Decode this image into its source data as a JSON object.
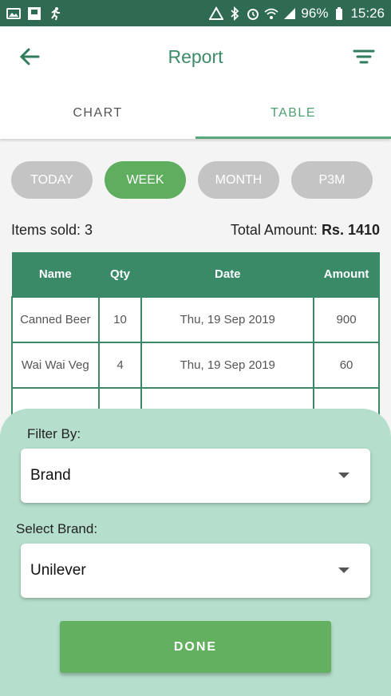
{
  "status_bar": {
    "battery_percent": "96%",
    "time": "15:26",
    "left_icons": [
      "image-icon",
      "screenshot-icon",
      "running-icon"
    ],
    "right_icons": [
      "network-icon",
      "bluetooth-icon",
      "alarm-icon",
      "wifi-icon",
      "signal-icon",
      "battery-icon"
    ]
  },
  "app_bar": {
    "title": "Report"
  },
  "tabs": [
    {
      "label": "CHART",
      "active": false
    },
    {
      "label": "TABLE",
      "active": true
    }
  ],
  "period_chips": [
    {
      "label": "TODAY",
      "active": false
    },
    {
      "label": "WEEK",
      "active": true
    },
    {
      "label": "MONTH",
      "active": false
    },
    {
      "label": "P3M",
      "active": false
    }
  ],
  "summary": {
    "items_sold": "Items sold: 3",
    "total_label": "Total Amount:",
    "total_value": "Rs. 1410"
  },
  "table": {
    "headers": [
      "Name",
      "Qty",
      "Date",
      "Amount"
    ],
    "rows": [
      [
        "Canned Beer",
        "10",
        "Thu, 19 Sep 2019",
        "900"
      ],
      [
        "Wai Wai Veg",
        "4",
        "Thu, 19 Sep 2019",
        "60"
      ]
    ]
  },
  "bottom_sheet": {
    "filter_label": "Filter By:",
    "filter_value": "Brand",
    "brand_label": "Select Brand:",
    "brand_value": "Unilever",
    "done_label": "DONE"
  },
  "colors": {
    "primary": "#3a8a68",
    "accent_green": "#5fae5f",
    "sheet_bg": "#b5dfcc",
    "chip_inactive": "#c4c4c4"
  }
}
